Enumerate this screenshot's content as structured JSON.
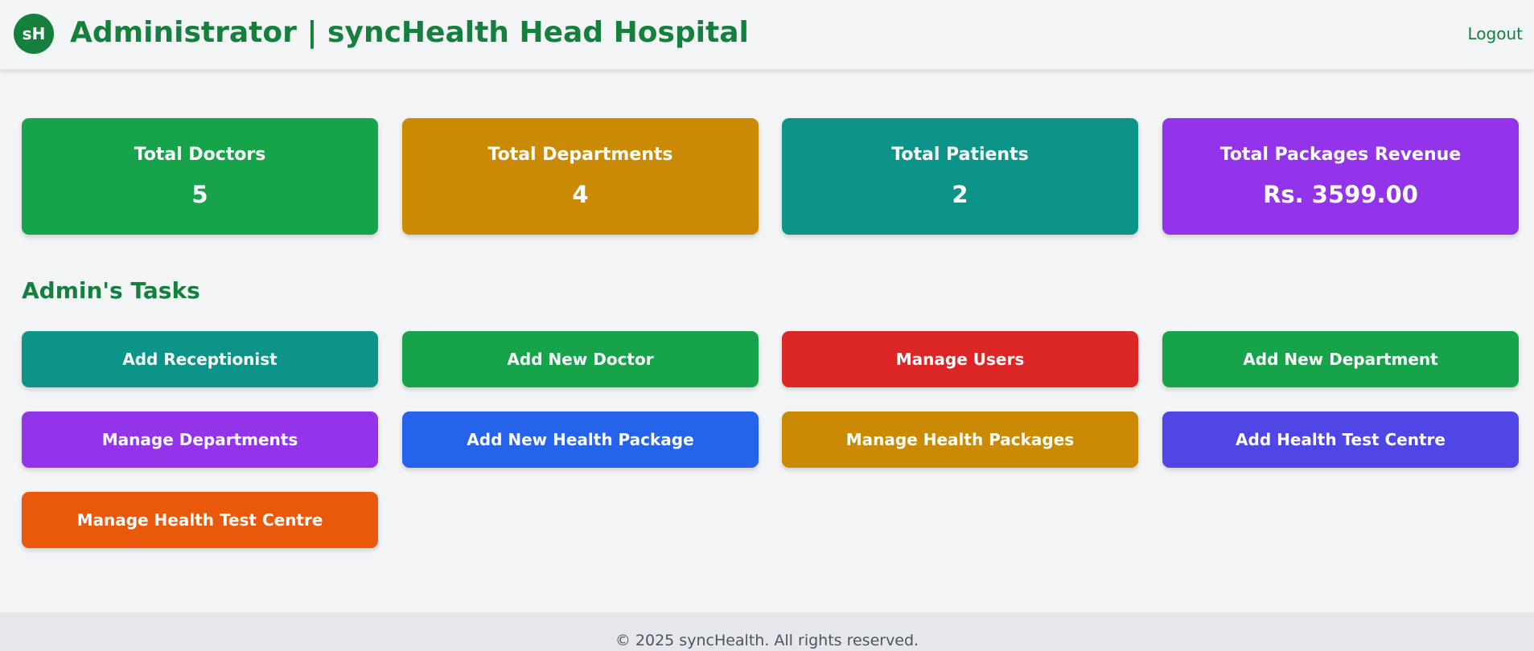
{
  "header": {
    "logo_text": "sH",
    "title": "Administrator | syncHealth Head Hospital",
    "logout_label": "Logout"
  },
  "stats": [
    {
      "label": "Total Doctors",
      "value": "5",
      "color": "#16a34a"
    },
    {
      "label": "Total Departments",
      "value": "4",
      "color": "#ca8a04"
    },
    {
      "label": "Total Patients",
      "value": "2",
      "color": "#0d9488"
    },
    {
      "label": "Total Packages Revenue",
      "value": "Rs. 3599.00",
      "color": "#9333ea"
    }
  ],
  "tasks_title": "Admin's Tasks",
  "tasks": [
    {
      "label": "Add Receptionist",
      "color": "#0d9488"
    },
    {
      "label": "Add New Doctor",
      "color": "#16a34a"
    },
    {
      "label": "Manage Users",
      "color": "#dc2626"
    },
    {
      "label": "Add New Department",
      "color": "#16a34a"
    },
    {
      "label": "Manage Departments",
      "color": "#9333ea"
    },
    {
      "label": "Add New Health Package",
      "color": "#2563eb"
    },
    {
      "label": "Manage Health Packages",
      "color": "#ca8a04"
    },
    {
      "label": "Add Health Test Centre",
      "color": "#4f46e5"
    },
    {
      "label": "Manage Health Test Centre",
      "color": "#ea580c"
    }
  ],
  "footer": {
    "text": "© 2025 syncHealth. All rights reserved."
  }
}
